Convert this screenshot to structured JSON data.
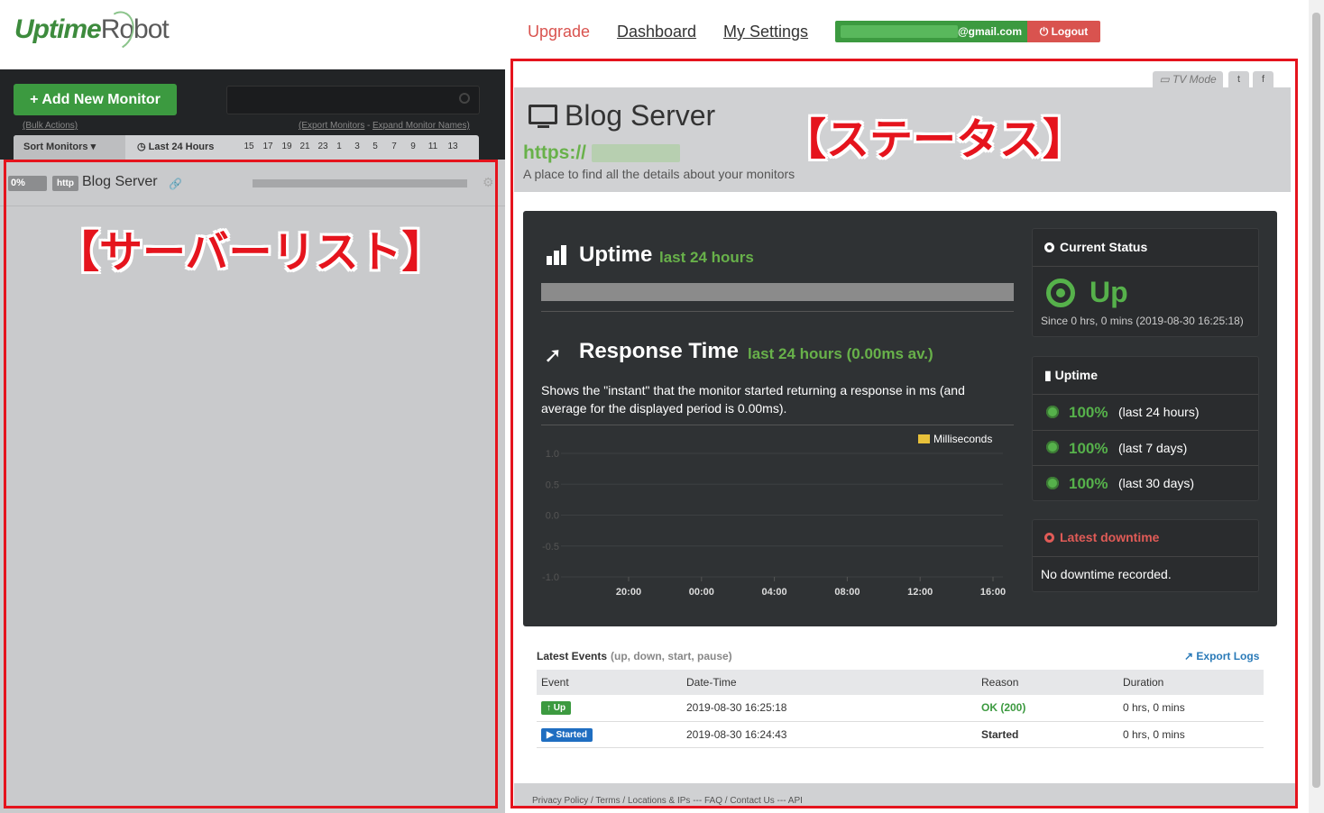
{
  "header": {
    "logo_text_a": "Uptime",
    "logo_text_b": "Robot",
    "nav": {
      "upgrade": "Upgrade",
      "dashboard": "Dashboard",
      "settings": "My Settings"
    },
    "email": "@gmail.com",
    "logout": "Logout"
  },
  "sidebar": {
    "add_button": "+ Add New Monitor",
    "bulk_actions": "(Bulk Actions)",
    "export_monitors": "(Export Monitors",
    "expand_names": "Expand Monitor Names)",
    "sort_label": "Sort Monitors",
    "period_label": "Last 24 Hours",
    "hours": [
      "15",
      "17",
      "19",
      "21",
      "23",
      "1",
      "3",
      "5",
      "7",
      "9",
      "11",
      "13"
    ],
    "monitors": [
      {
        "percent": "0%",
        "type": "http",
        "name": "Blog Server"
      }
    ]
  },
  "annotations": {
    "left_label": "【サーバーリスト】",
    "right_label": "【ステータス】"
  },
  "detail": {
    "tv_mode": "TV Mode",
    "title": "Blog Server",
    "url_prefix": "https://",
    "url_suffix": "/",
    "description": "A place to find all the details about your monitors",
    "uptime_heading": "Uptime",
    "uptime_sub": "last 24 hours",
    "response_heading": "Response Time",
    "response_sub": "last 24 hours",
    "response_avg": "(0.00ms av.)",
    "response_desc": "Shows the \"instant\" that the monitor started returning a response in ms (and average for the displayed period is 0.00ms).",
    "current_status_h": "Current Status",
    "current_status": "Up",
    "since": "Since 0 hrs, 0 mins (2019-08-30 16:25:18)",
    "uptime_card_h": "Uptime",
    "uptime_rows": [
      {
        "pct": "100%",
        "label": "(last 24 hours)"
      },
      {
        "pct": "100%",
        "label": "(last 7 days)"
      },
      {
        "pct": "100%",
        "label": "(last 30 days)"
      }
    ],
    "latest_downtime_h": "Latest downtime",
    "latest_downtime": "No downtime recorded."
  },
  "chart_data": {
    "type": "line",
    "legend": [
      "Milliseconds"
    ],
    "series": [
      {
        "name": "Milliseconds",
        "values": []
      }
    ],
    "x_ticks": [
      "20:00",
      "00:00",
      "04:00",
      "08:00",
      "12:00",
      "16:00"
    ],
    "y_ticks": [
      "1.0",
      "0.5",
      "0.0",
      "-0.5",
      "-1.0"
    ],
    "ylim": [
      -1.0,
      1.0
    ],
    "legend_color": "#e8c13a"
  },
  "events": {
    "heading": "Latest Events",
    "sub": "(up, down, start, pause)",
    "export": "Export Logs",
    "columns": [
      "Event",
      "Date-Time",
      "Reason",
      "Duration"
    ],
    "rows": [
      {
        "event": "Up",
        "datetime": "2019-08-30 16:25:18",
        "reason": "OK (200)",
        "duration": "0 hrs, 0 mins"
      },
      {
        "event": "Started",
        "datetime": "2019-08-30 16:24:43",
        "reason": "Started",
        "duration": "0 hrs, 0 mins"
      }
    ]
  },
  "footer": "Privacy Policy / Terms / Locations & IPs --- FAQ / Contact Us --- API"
}
